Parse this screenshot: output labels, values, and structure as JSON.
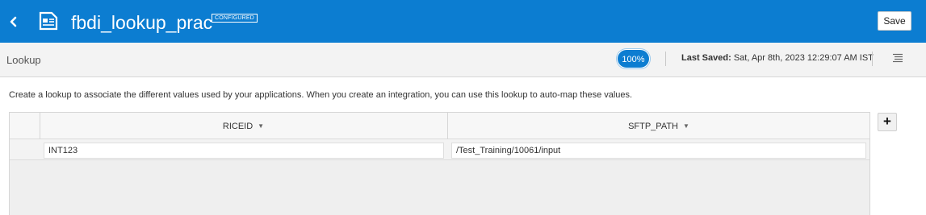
{
  "header": {
    "title": "fbdi_lookup_prac",
    "badge": "CONFIGURED",
    "save_label": "Save",
    "color": "#0c7dd1"
  },
  "subbar": {
    "title": "Lookup",
    "zoom": "100%",
    "last_saved_label": "Last Saved:",
    "last_saved_value": "Sat, Apr 8th, 2023 12:29:07 AM IST"
  },
  "description": "Create a lookup to associate the different values used by your applications. When you create an integration, you can use this lookup to auto-map these values.",
  "table": {
    "columns": [
      "RICEID",
      "SFTP_PATH"
    ],
    "rows": [
      [
        "INT123",
        "/Test_Training/10061/input"
      ]
    ]
  },
  "icons": {
    "back": "chevron-left-icon",
    "document": "document-icon",
    "menu": "hamburger-menu-icon",
    "add": "plus-icon",
    "sort": "caret-down-icon"
  }
}
